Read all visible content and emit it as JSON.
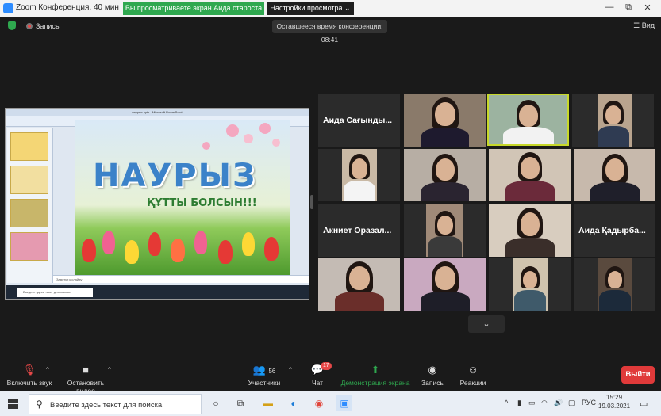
{
  "window": {
    "title": "Zoom Конференция, 40 мин",
    "share_banner": "Вы просматриваете экран Аида староста",
    "view_options": "Настройки просмотра ⌄",
    "minimize": "—",
    "restore": "⧉",
    "close": "✕"
  },
  "meeting": {
    "record_label": "Запись",
    "timer": "Оставшееся время конференции: 08:41",
    "view_label": "Вид"
  },
  "shared_screen": {
    "ppt_title": "наурыз.pptx - Microsoft PowerPoint",
    "slide_title": "НАУРЫЗ",
    "slide_subtitle": "ҚҰТТЫ БОЛСЫН!!!",
    "notes_label": "Заметки к слайду",
    "inner_search": "Введите здесь текст для поиска"
  },
  "gallery": {
    "tile_names": {
      "r1c1": "Аида Сағынды...",
      "r3c1": "Акниет Оразал...",
      "r3c4": "Аида Қадырба..."
    },
    "more_chevron": "⌄"
  },
  "controls": {
    "unmute": "Включить звук",
    "stop_video": "Остановить видео",
    "participants": "Участники",
    "participants_count": "56",
    "chat": "Чат",
    "chat_badge": "17",
    "share": "Демонстрация экрана",
    "record": "Запись",
    "reactions": "Реакции",
    "leave": "Выйти",
    "accent": "#2fa84f",
    "leave_color": "#e03a3a"
  },
  "taskbar": {
    "search_placeholder": "Введите здесь текст для поиска",
    "lang": "РУС",
    "time": "15:29",
    "date": "19.03.2021"
  }
}
